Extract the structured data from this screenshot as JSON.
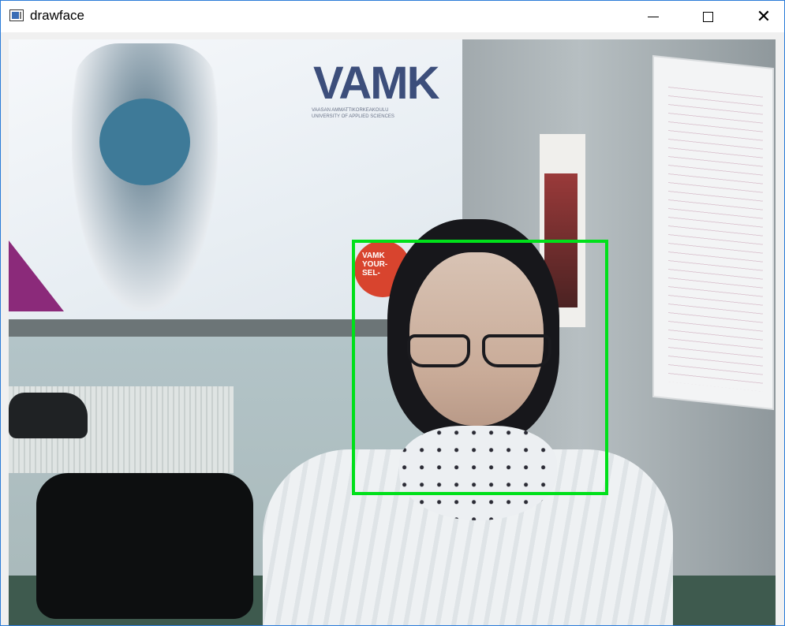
{
  "window": {
    "title": "drawface",
    "controls": {
      "minimize": "minimize-icon",
      "maximize": "maximize-icon",
      "close": "close-icon"
    },
    "accent_color": "#2b7bd8"
  },
  "video_frame": {
    "description_icon": "camera-frame",
    "detection_box_color": "#00e01a",
    "poster_logo": "VAMK",
    "poster_subtitle": "VAASAN AMMATTIKORKEAKOULU\nUNIVERSITY OF APPLIED SCIENCES",
    "badge_text": "VAMK\nYOUR-\nSEL-"
  }
}
